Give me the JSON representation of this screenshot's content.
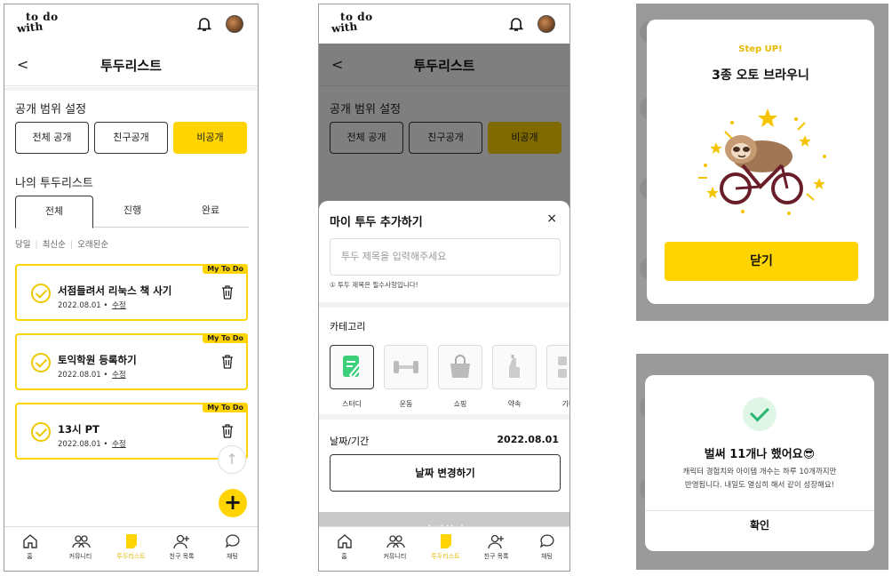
{
  "brand": {
    "logo_line1": "to do",
    "logo_line2": "with"
  },
  "header": {
    "title": "투두리스트",
    "back_label": "<"
  },
  "visibility": {
    "title": "공개 범위 설정",
    "options": [
      "전체 공개",
      "친구공개",
      "비공개"
    ],
    "selected": "비공개"
  },
  "my_list": {
    "title": "나의 투두리스트",
    "tabs": [
      "전체",
      "진행",
      "완료"
    ],
    "active_tab": "전체",
    "sort": [
      "당일",
      "최신순",
      "오래된순"
    ]
  },
  "todos": [
    {
      "tag": "My To Do",
      "title": "서점들려서 리눅스 책 사기",
      "date": "2022.08.01",
      "edit": "수정"
    },
    {
      "tag": "My To Do",
      "title": "토익학원 등록하기",
      "date": "2022.08.01",
      "edit": "수정"
    },
    {
      "tag": "My To Do",
      "title": "13시 PT",
      "date": "2022.08.01",
      "edit": "수정"
    }
  ],
  "fab": {
    "up": "↑",
    "add": "+"
  },
  "bottom_nav": [
    "홈",
    "커뮤니티",
    "투두리스트",
    "친구 목록",
    "채팅"
  ],
  "active_nav": "투두리스트",
  "add_sheet": {
    "title": "마이 투두 추가하기",
    "close": "×",
    "input_placeholder": "투두 제목을 입력해주세요",
    "hint": "① 투두 제목은 필수사항입니다!",
    "category_label": "카테고리",
    "categories": [
      "스터디",
      "운동",
      "쇼핑",
      "약속",
      "기타"
    ],
    "date_label": "날짜/기간",
    "date_value": "2022.08.01",
    "change_date": "날짜 변경하기",
    "submit": "추가하기"
  },
  "levelup_modal": {
    "step": "Step UP!",
    "title": "3종 오토 브라우니",
    "close": "닫기"
  },
  "count_modal": {
    "title": "벌써 11개나 했어요😎",
    "desc_line1": "캐릭터 경험치와 아이템 개수는 하루 10개까지만",
    "desc_line2": "반영됩니다. 내일도 열심히 해서 같이 성장해요!",
    "confirm": "확인"
  },
  "colors": {
    "accent": "#ffd400",
    "dim": "#808080",
    "success": "#2bb673"
  }
}
